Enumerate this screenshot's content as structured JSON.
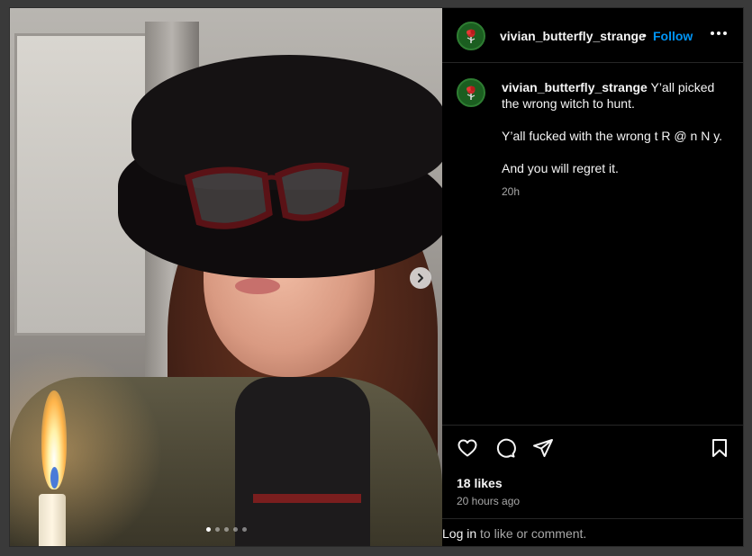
{
  "post": {
    "username": "vivian_butterfly_strange",
    "separator": "•",
    "follow_label": "Follow",
    "caption": {
      "username": "vivian_butterfly_strange",
      "line1": "Y’all picked the wrong witch to hunt.",
      "line2": "Y’all fucked with the wrong t R @ n N y.",
      "line3": "And you will regret it.",
      "time": "20h"
    },
    "likes": "18 likes",
    "posted_ago": "20 hours ago",
    "login_link": "Log in",
    "login_rest": " to like or comment.",
    "carousel": {
      "slides": 5,
      "active_index": 0
    }
  },
  "icons": {
    "more": "more-options-icon",
    "heart": "heart-icon",
    "comment": "comment-icon",
    "share": "share-icon",
    "bookmark": "bookmark-icon",
    "next": "chevron-right-icon"
  },
  "colors": {
    "background": "#000000",
    "text": "#f5f5f5",
    "muted": "#a8a8a8",
    "accent": "#0095f6",
    "avatar_bg": "#1b5e20"
  }
}
